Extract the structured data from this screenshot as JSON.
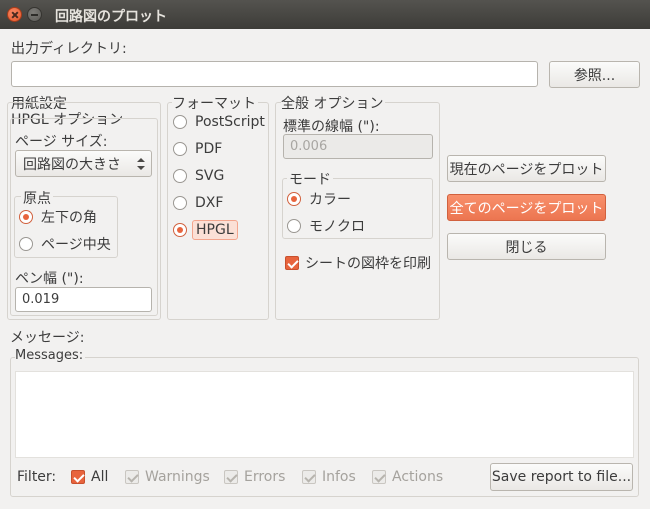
{
  "window": {
    "title": "回路図のプロット"
  },
  "output_dir": {
    "label": "出力ディレクトリ:",
    "value": "",
    "browse_button": "参照..."
  },
  "paper": {
    "group_label": "用紙設定",
    "hpgl_options_label": "HPGL オプション",
    "page_size_label": "ページ サイズ:",
    "page_size_value": "回路図の大きさ",
    "origin": {
      "label": "原点",
      "options": [
        {
          "label": "左下の角",
          "selected": true
        },
        {
          "label": "ページ中央",
          "selected": false
        }
      ]
    },
    "pen_width_label": "ペン幅 (\"):",
    "pen_width_value": "0.019"
  },
  "format": {
    "label": "フォーマット",
    "options": [
      {
        "label": "PostScript",
        "selected": false
      },
      {
        "label": "PDF",
        "selected": false
      },
      {
        "label": "SVG",
        "selected": false
      },
      {
        "label": "DXF",
        "selected": false
      },
      {
        "label": "HPGL",
        "selected": true
      }
    ]
  },
  "general": {
    "label": "全般 オプション",
    "line_width_label": "標準の線幅 (\"):",
    "line_width_value": "0.006",
    "mode": {
      "label": "モード",
      "options": [
        {
          "label": "カラー",
          "selected": true
        },
        {
          "label": "モノクロ",
          "selected": false
        }
      ]
    },
    "print_frame": {
      "label": "シートの図枠を印刷",
      "checked": true
    }
  },
  "actions": {
    "plot_current": "現在のページをプロット",
    "plot_all": "全てのページをプロット",
    "close": "閉じる"
  },
  "messages": {
    "label": "メッセージ:",
    "frame_label": "Messages:",
    "filter_label": "Filter:",
    "filters": [
      {
        "label": "All",
        "checked": true
      },
      {
        "label": "Warnings",
        "checked": false
      },
      {
        "label": "Errors",
        "checked": false
      },
      {
        "label": "Infos",
        "checked": false
      },
      {
        "label": "Actions",
        "checked": false
      }
    ],
    "save_button": "Save report to file..."
  },
  "colors": {
    "accent": "#e8643d",
    "titlebar": "#3d3c38",
    "background": "#f2f1f0"
  }
}
